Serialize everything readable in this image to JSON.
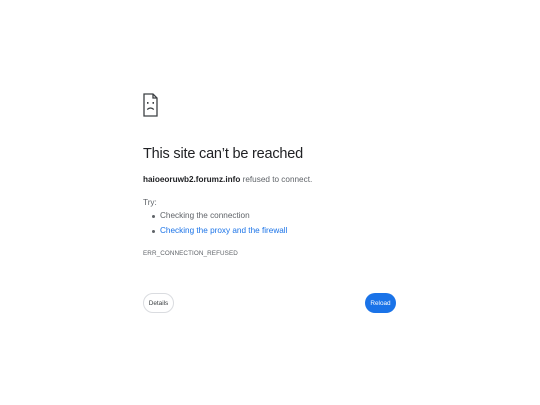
{
  "error": {
    "title": "This site can’t be reached",
    "host": "haioeoruwb2.forumz.info",
    "message": " refused to connect.",
    "try_label": "Try:",
    "suggestions": [
      {
        "label": "Checking the connection",
        "is_link": false
      },
      {
        "label": "Checking the proxy and the firewall",
        "is_link": true
      }
    ],
    "error_code": "ERR_CONNECTION_REFUSED"
  },
  "buttons": {
    "details_label": "Details",
    "reload_label": "Reload"
  },
  "colors": {
    "accent": "#1a73e8",
    "title_text": "#202124",
    "body_text": "#5f6368",
    "background": "#ffffff"
  },
  "icons": {
    "error_icon": "sad-document-icon"
  }
}
